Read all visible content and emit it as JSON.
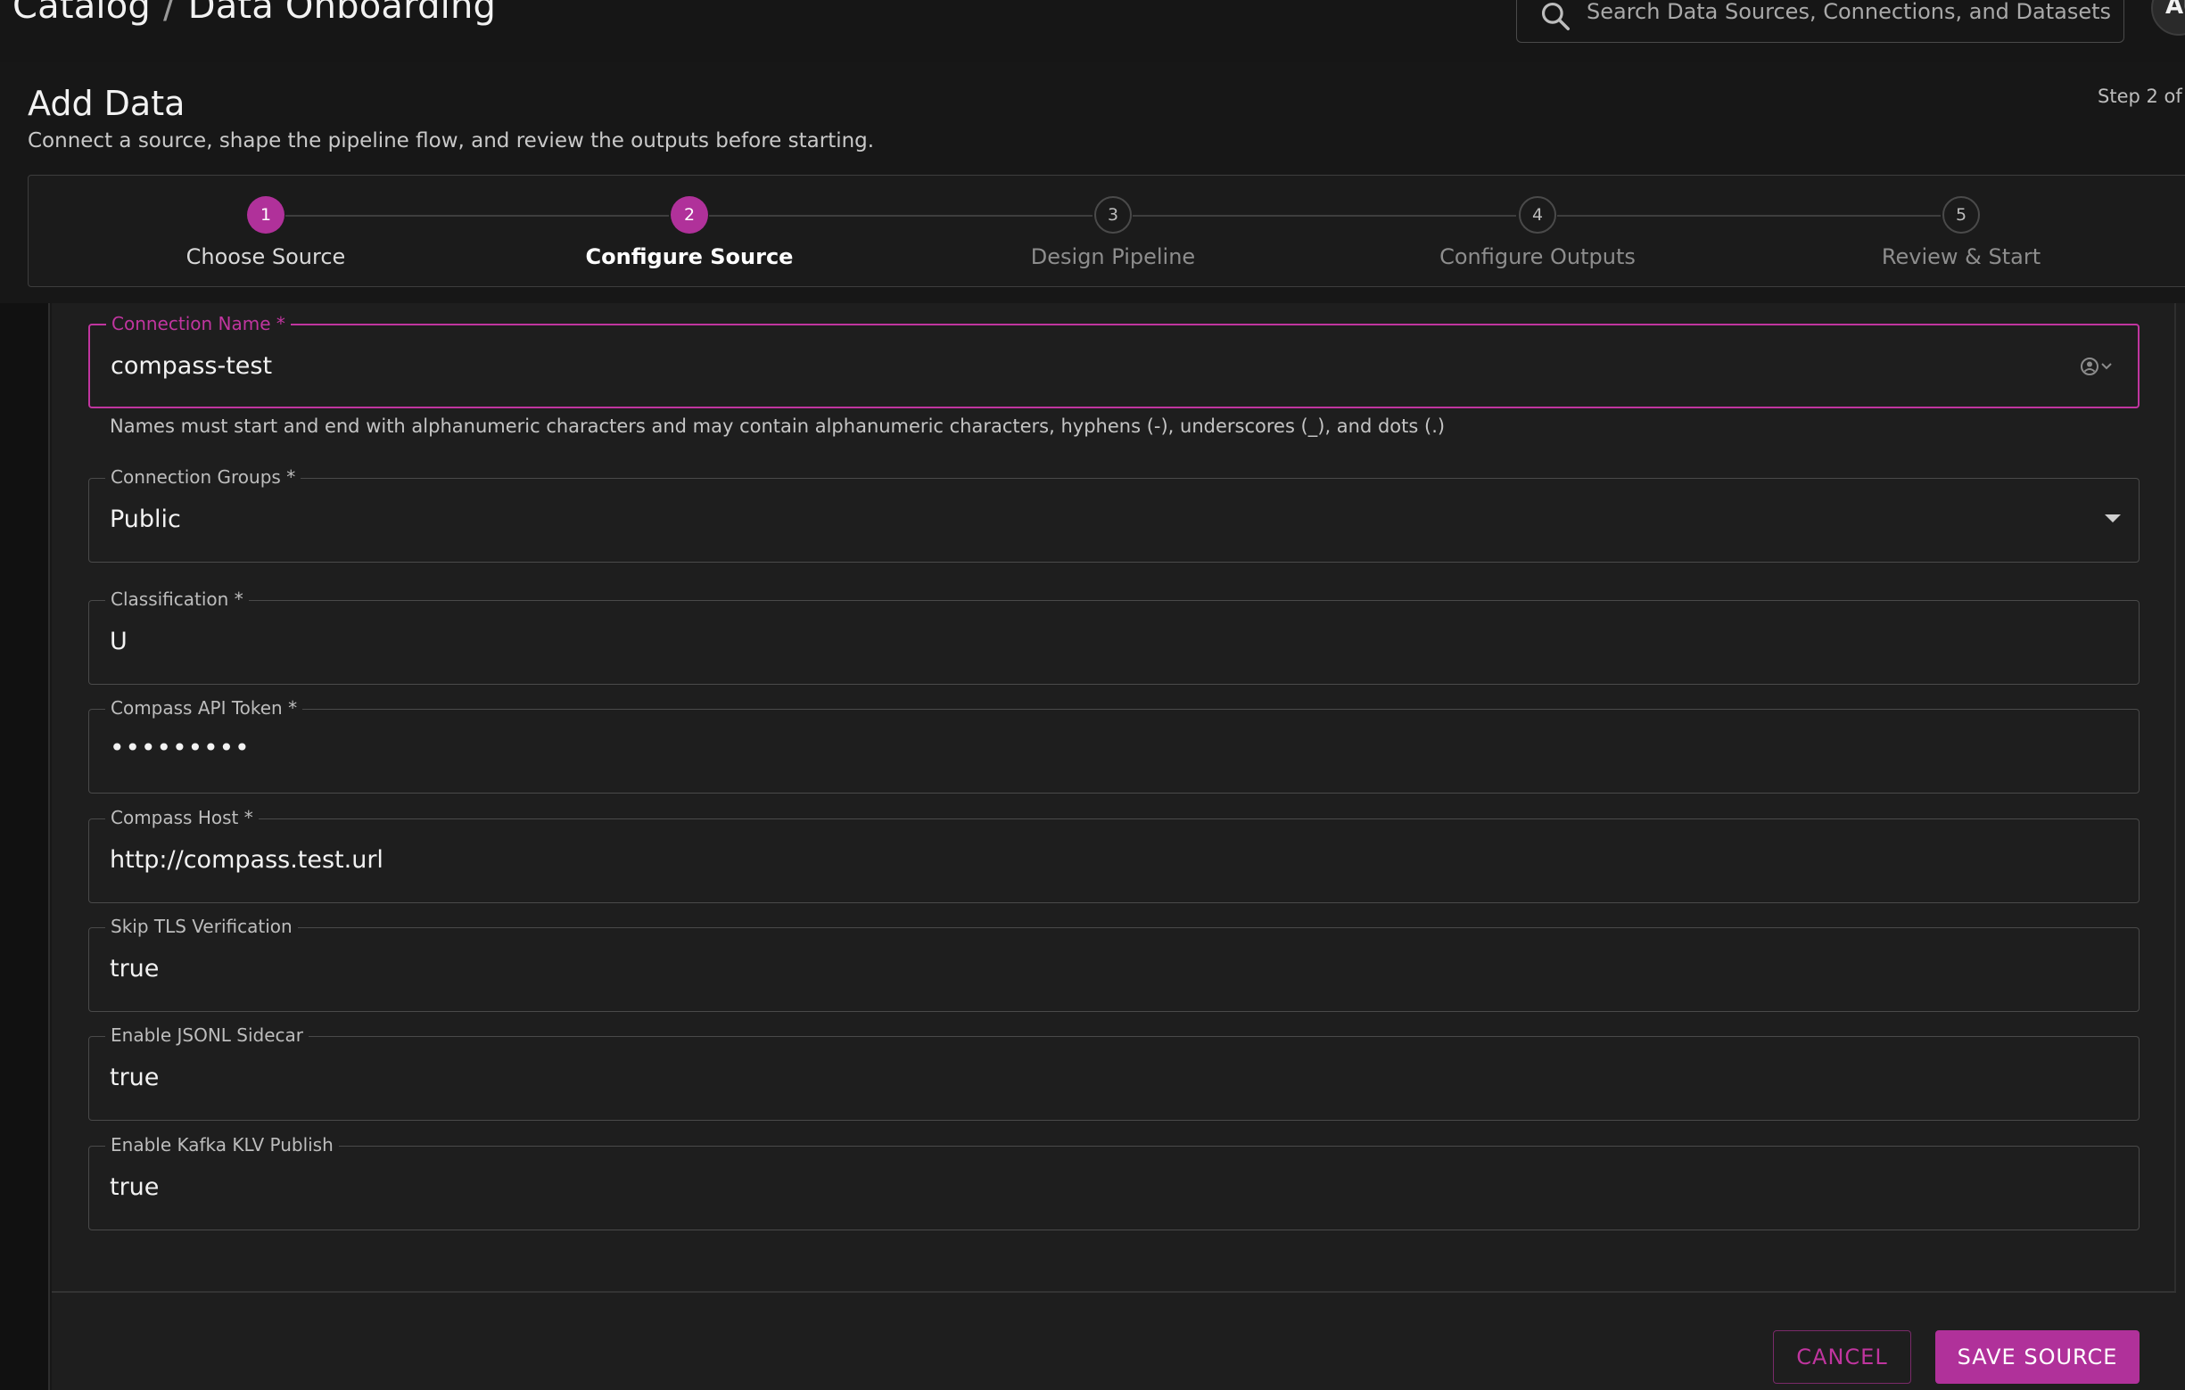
{
  "header": {
    "breadcrumb": [
      "Catalog",
      "Data Onboarding"
    ],
    "breadcrumb_separator": "/",
    "search_placeholder": "Search Data Sources, Connections, and Datasets",
    "avatar_initials": "AU"
  },
  "page": {
    "title": "Add Data",
    "subtitle": "Connect a source, shape the pipeline flow, and review the outputs before starting.",
    "step_counter": "Step 2 of"
  },
  "stepper": {
    "current_step": 2,
    "steps": [
      {
        "number": "1",
        "label": "Choose Source",
        "state": "completed"
      },
      {
        "number": "2",
        "label": "Configure Source",
        "state": "current"
      },
      {
        "number": "3",
        "label": "Design Pipeline",
        "state": "upcoming"
      },
      {
        "number": "4",
        "label": "Configure Outputs",
        "state": "upcoming"
      },
      {
        "number": "5",
        "label": "Review & Start",
        "state": "upcoming"
      }
    ]
  },
  "form": {
    "connection_name": {
      "label": "Connection Name *",
      "value": "compass-test",
      "helper": "Names must start and end with alphanumeric characters and may contain alphanumeric characters, hyphens (-), underscores (_), and dots (.)"
    },
    "connection_groups": {
      "label": "Connection Groups *",
      "value": "Public"
    },
    "classification": {
      "label": "Classification *",
      "value": "U"
    },
    "api_token": {
      "label": "Compass API Token *",
      "value": "•••••••••"
    },
    "host": {
      "label": "Compass Host *",
      "value": "http://compass.test.url"
    },
    "skip_tls": {
      "label": "Skip TLS Verification",
      "value": "true"
    },
    "jsonl_sidecar": {
      "label": "Enable JSONL Sidecar",
      "value": "true"
    },
    "kafka_klv": {
      "label": "Enable Kafka KLV Publish",
      "value": "true"
    }
  },
  "actions": {
    "cancel_label": "CANCEL",
    "save_label": "SAVE SOURCE"
  },
  "colors": {
    "accent": "#b0319a",
    "background": "#171717",
    "panel": "#1e1e1e"
  }
}
